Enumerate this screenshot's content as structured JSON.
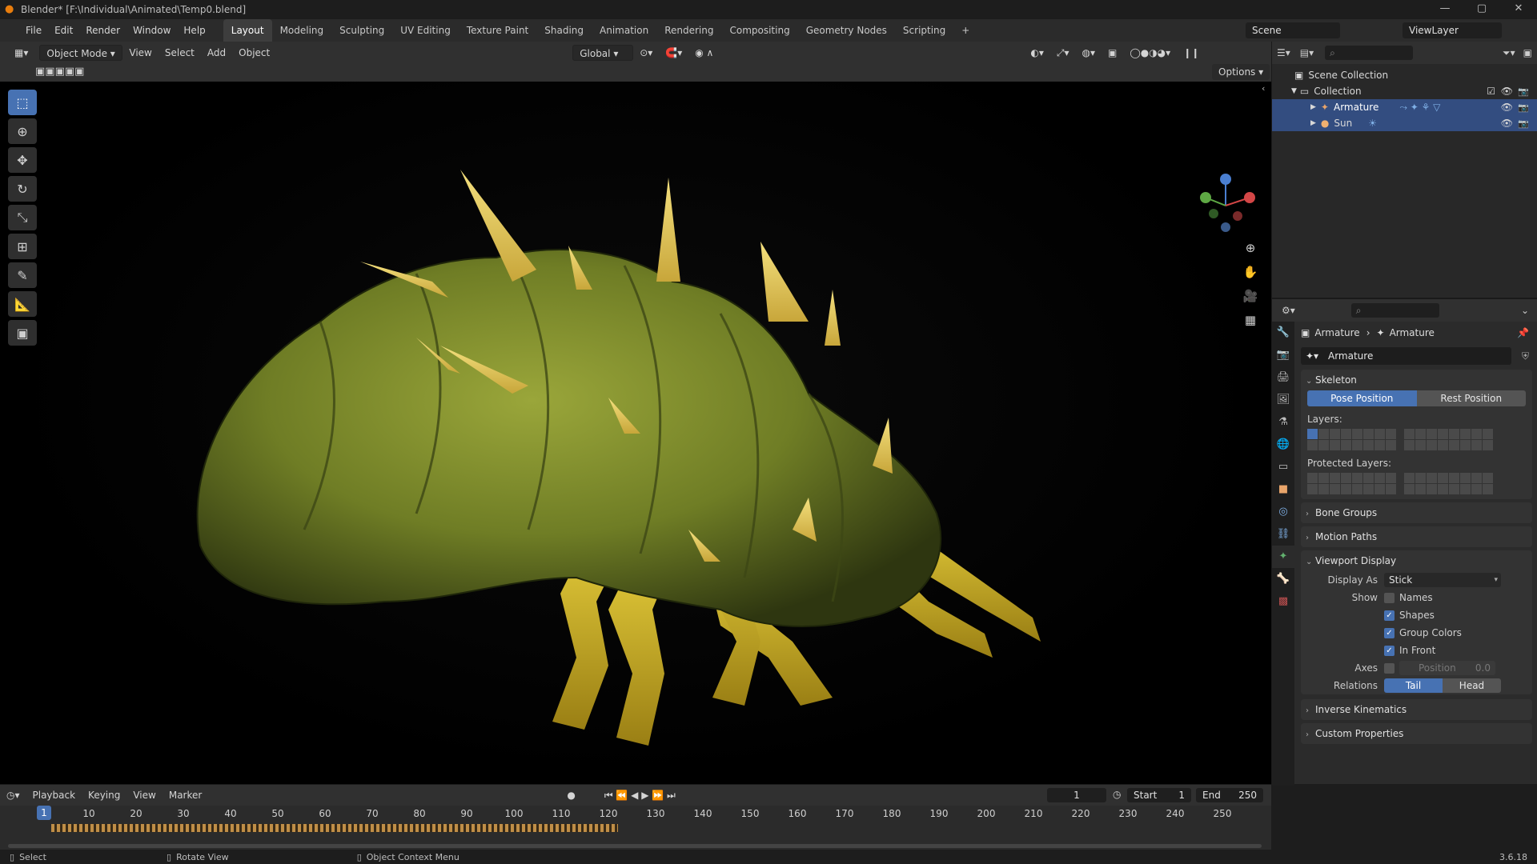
{
  "window": {
    "title": "Blender* [F:\\Individual\\Animated\\Temp0.blend]",
    "controls": [
      "—",
      "▢",
      "✕"
    ]
  },
  "menu": [
    "File",
    "Edit",
    "Render",
    "Window",
    "Help"
  ],
  "workspaces": [
    "Layout",
    "Modeling",
    "Sculpting",
    "UV Editing",
    "Texture Paint",
    "Shading",
    "Animation",
    "Rendering",
    "Compositing",
    "Geometry Nodes",
    "Scripting"
  ],
  "active_workspace": "Layout",
  "scene": "Scene",
  "view_layer": "ViewLayer",
  "viewport_header": {
    "mode": "Object Mode",
    "menus": [
      "View",
      "Select",
      "Add",
      "Object"
    ],
    "orientation": "Global",
    "options_label": "Options"
  },
  "outliner": {
    "rows": [
      {
        "label": "Scene Collection",
        "icon": "scene-collection-icon",
        "indent": 0,
        "selected": false
      },
      {
        "label": "Collection",
        "icon": "collection-icon",
        "indent": 1,
        "selected": false
      },
      {
        "label": "Armature",
        "icon": "armature-icon",
        "indent": 2,
        "selected": true
      },
      {
        "label": "Sun",
        "icon": "light-icon",
        "indent": 2,
        "selected": true
      }
    ]
  },
  "properties": {
    "breadcrumb_object": "Armature",
    "breadcrumb_data": "Armature",
    "data_name": "Armature",
    "skeleton_title": "Skeleton",
    "pose_position": "Pose Position",
    "rest_position": "Rest Position",
    "layers_label": "Layers:",
    "protected_layers_label": "Protected Layers:",
    "bone_groups": "Bone Groups",
    "motion_paths": "Motion Paths",
    "viewport_display": "Viewport Display",
    "display_as_label": "Display As",
    "display_as_value": "Stick",
    "show_label": "Show",
    "names": "Names",
    "shapes": "Shapes",
    "group_colors": "Group Colors",
    "in_front": "In Front",
    "axes_label": "Axes",
    "position_label": "Position",
    "position_value": "0.0",
    "relations_label": "Relations",
    "tail": "Tail",
    "head": "Head",
    "inverse_kinematics": "Inverse Kinematics",
    "custom_properties": "Custom Properties",
    "checks": {
      "names": false,
      "shapes": true,
      "group_colors": true,
      "in_front": true,
      "axes": false
    }
  },
  "timeline": {
    "menus": [
      "Playback",
      "Keying",
      "View",
      "Marker"
    ],
    "current_frame": "1",
    "start_label": "Start",
    "start": "1",
    "end_label": "End",
    "end": "250",
    "ticks": [
      "1",
      "10",
      "20",
      "30",
      "40",
      "50",
      "60",
      "70",
      "80",
      "90",
      "100",
      "110",
      "120",
      "130",
      "140",
      "150",
      "160",
      "170",
      "180",
      "190",
      "200",
      "210",
      "220",
      "230",
      "240",
      "250"
    ]
  },
  "statusbar": {
    "select": "Select",
    "rotate": "Rotate View",
    "context": "Object Context Menu",
    "version": "3.6.18"
  }
}
